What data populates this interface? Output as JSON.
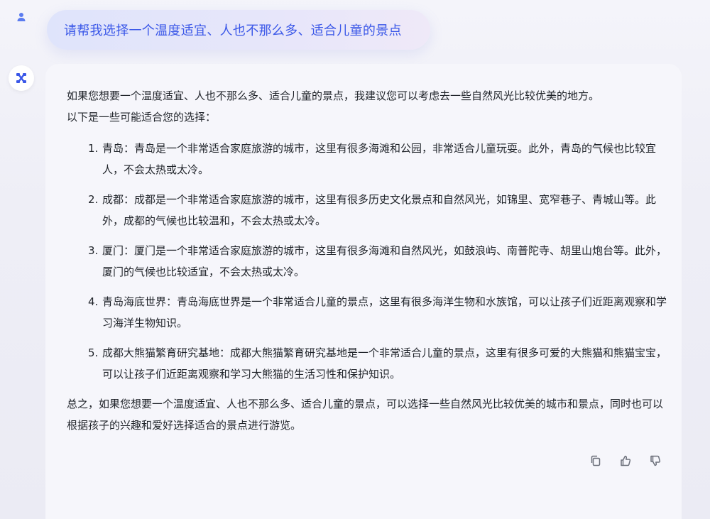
{
  "conversation": {
    "user_message": "请帮我选择一个温度适宜、人也不那么多、适合儿童的景点",
    "answer": {
      "intro_line1": "如果您想要一个温度适宜、人也不那么多、适合儿童的景点，我建议您可以考虑去一些自然风光比较优美的地方。",
      "intro_line2": "以下是一些可能适合您的选择：",
      "items": [
        {
          "num": "1.",
          "text": "青岛：青岛是一个非常适合家庭旅游的城市，这里有很多海滩和公园，非常适合儿童玩耍。此外，青岛的气候也比较宜人，不会太热或太冷。"
        },
        {
          "num": "2.",
          "text": "成都：成都是一个非常适合家庭旅游的城市，这里有很多历史文化景点和自然风光，如锦里、宽窄巷子、青城山等。此外，成都的气候也比较温和，不会太热或太冷。"
        },
        {
          "num": "3.",
          "text": "厦门：厦门是一个非常适合家庭旅游的城市，这里有很多海滩和自然风光，如鼓浪屿、南普陀寺、胡里山炮台等。此外，厦门的气候也比较适宜，不会太热或太冷。"
        },
        {
          "num": "4.",
          "text": "青岛海底世界：青岛海底世界是一个非常适合儿童的景点，这里有很多海洋生物和水族馆，可以让孩子们近距离观察和学习海洋生物知识。"
        },
        {
          "num": "5.",
          "text": "成都大熊猫繁育研究基地：成都大熊猫繁育研究基地是一个非常适合儿童的景点，这里有很多可爱的大熊猫和熊猫宝宝，可以让孩子们近距离观察和学习大熊猫的生活习性和保护知识。"
        }
      ],
      "summary": "总之，如果您想要一个温度适宜、人也不那么多、适合儿童的景点，可以选择一些自然风光比较优美的城市和景点，同时也可以根据孩子的兴趣和爱好选择适合的景点进行游览。"
    }
  },
  "icons": {
    "user_avatar": "user-icon",
    "bot_avatar": "bot-logo-icon",
    "copy": "copy-icon",
    "like": "thumbs-up-icon",
    "dislike": "thumbs-down-icon"
  },
  "colors": {
    "accent": "#3a57e8",
    "user_bubble": "#e3e5fa",
    "card": "#f6f6fb",
    "text": "#1f2329"
  }
}
